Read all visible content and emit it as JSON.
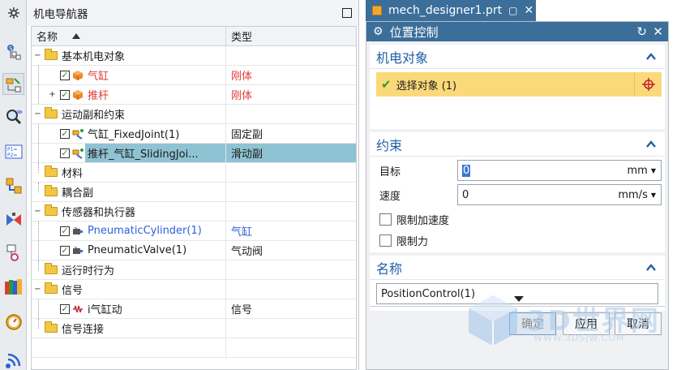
{
  "toolbar": {
    "icons": [
      "settings-icon",
      "assembly-navigator-icon",
      "mechatronics-navigator-icon",
      "search-icon",
      "part-navigator-icon",
      "constraint-icon",
      "valve-icon",
      "signal-icon",
      "library-icon",
      "runtime-icon",
      "network-icon"
    ]
  },
  "navigator": {
    "title": "机电导航器",
    "columns": {
      "name": "名称",
      "type": "类型"
    },
    "rows": [
      {
        "name": "基本机电对象",
        "type": "",
        "level": 0,
        "expander": "-",
        "kind": "folder"
      },
      {
        "name": "气缸",
        "type": "刚体",
        "level": 1,
        "expander": "",
        "kind": "rigid",
        "color": "red"
      },
      {
        "name": "推杆",
        "type": "刚体",
        "level": 1,
        "expander": "+",
        "kind": "rigid",
        "color": "red"
      },
      {
        "name": "运动副和约束",
        "type": "",
        "level": 0,
        "expander": "-",
        "kind": "folder"
      },
      {
        "name": "气缸_FixedJoint(1)",
        "type": "固定副",
        "level": 1,
        "expander": "",
        "kind": "joint"
      },
      {
        "name": "推杆_气缸_SlidingJoi...",
        "type": "滑动副",
        "level": 1,
        "expander": "",
        "kind": "joint",
        "selected": true
      },
      {
        "name": "材料",
        "type": "",
        "level": 0,
        "expander": "",
        "kind": "folder"
      },
      {
        "name": "耦合副",
        "type": "",
        "level": 0,
        "expander": "",
        "kind": "folder"
      },
      {
        "name": "传感器和执行器",
        "type": "",
        "level": 0,
        "expander": "-",
        "kind": "folder"
      },
      {
        "name": "PneumaticCylinder(1)",
        "type": "气缸",
        "level": 1,
        "expander": "",
        "kind": "actuator",
        "color": "blue"
      },
      {
        "name": "PneumaticValve(1)",
        "type": "气动阀",
        "level": 1,
        "expander": "",
        "kind": "actuator"
      },
      {
        "name": "运行时行为",
        "type": "",
        "level": 0,
        "expander": "",
        "kind": "folder"
      },
      {
        "name": "信号",
        "type": "",
        "level": 0,
        "expander": "-",
        "kind": "folder"
      },
      {
        "name": "i气缸动",
        "type": "信号",
        "level": 1,
        "expander": "",
        "kind": "signal"
      },
      {
        "name": "信号连接",
        "type": "",
        "level": 0,
        "expander": "",
        "kind": "folder"
      }
    ]
  },
  "tab": {
    "label": "mech_designer1.prt"
  },
  "dialog": {
    "title": "位置控制",
    "object_section": {
      "header": "机电对象",
      "select_label": "选择对象 (1)"
    },
    "constraint_section": {
      "header": "约束",
      "target_label": "目标",
      "target_value": "0",
      "target_unit": "mm",
      "speed_label": "速度",
      "speed_value": "0",
      "speed_unit": "mm/s",
      "limit_accel_label": "限制加速度",
      "limit_force_label": "限制力"
    },
    "name_section": {
      "header": "名称",
      "value": "PositionControl(1)"
    },
    "buttons": {
      "ok": "确定",
      "apply": "应用",
      "cancel": "取消"
    }
  },
  "watermark": {
    "text": "3D世界网",
    "url": "WWW.3DSJW.COM"
  }
}
